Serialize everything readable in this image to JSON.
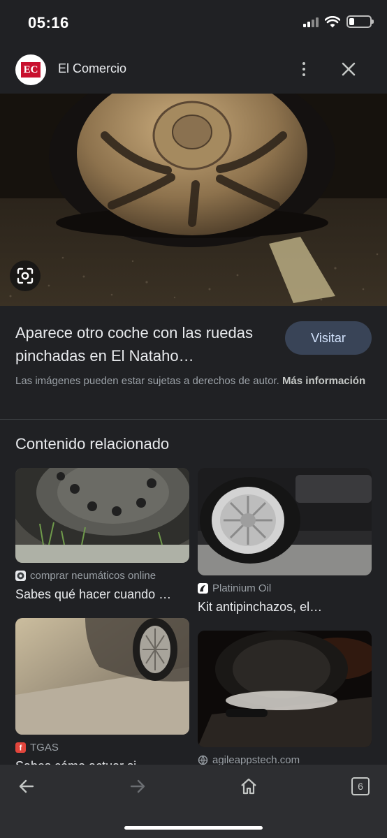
{
  "status_bar": {
    "time": "05:16",
    "icons": [
      "signal-icon",
      "wifi-icon",
      "battery-icon"
    ],
    "battery_level": 0.25
  },
  "source": {
    "logo_text": "EC",
    "name": "El Comercio",
    "logo_color": "#c8102e"
  },
  "result": {
    "title": "Aparece otro coche con las ruedas pinchadas en El Nataho…",
    "visit_label": "Visitar",
    "copyright_text": "Las imágenes pueden estar sujetas a derechos de autor.",
    "copyright_link": "Más información"
  },
  "related": {
    "heading": "Contenido relacionado",
    "items": [
      {
        "source": "comprar neumáticos online",
        "title": "Sabes qué hacer cuando …"
      },
      {
        "source": "Platinium Oil",
        "title": "Kit antipinchazos, el…"
      },
      {
        "source": "TGAS",
        "title": "Sabes cómo actuar si…"
      },
      {
        "source": "agileappstech.com",
        "title": ""
      }
    ]
  },
  "nav": {
    "tab_count": "6",
    "icons": [
      "back-arrow-icon",
      "forward-arrow-icon",
      "home-icon",
      "tabs-icon"
    ]
  },
  "colors": {
    "background": "#202124",
    "visit_button": "#394457",
    "nav_bar": "#2d2e31"
  }
}
